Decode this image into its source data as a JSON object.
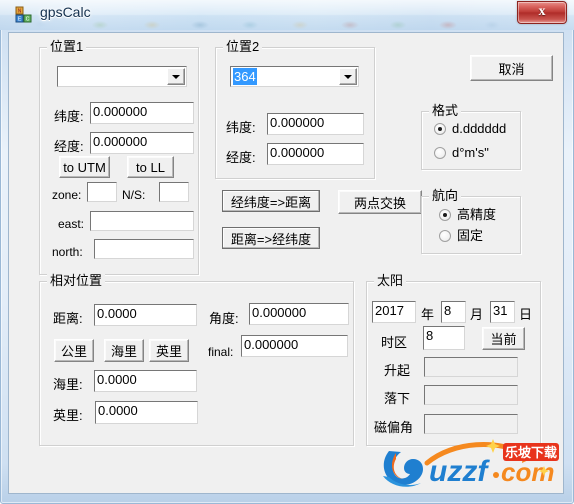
{
  "window": {
    "title": "gpsCalc",
    "icon": "app-blocks-icon",
    "close_label": "x"
  },
  "cancel_button": "取消",
  "position1": {
    "title": "位置1",
    "combo_value": "",
    "lat_label": "纬度:",
    "lat_value": "0.000000",
    "lon_label": "经度:",
    "lon_value": "0.000000",
    "to_utm": "to UTM",
    "to_ll": "to LL",
    "zone_label": "zone:",
    "zone_value": "",
    "ns_label": "N/S:",
    "ns_value": "",
    "east_label": "east:",
    "east_value": "",
    "north_label": "north:",
    "north_value": ""
  },
  "position2": {
    "title": "位置2",
    "combo_value": "364",
    "lat_label": "纬度:",
    "lat_value": "0.000000",
    "lon_label": "经度:",
    "lon_value": "0.000000"
  },
  "actions": {
    "latlon_to_dist": "经纬度=>距离",
    "dist_to_latlon": "距离=>经纬度",
    "swap_points": "两点交换"
  },
  "format": {
    "title": "格式",
    "options": [
      {
        "label": "d.dddddd",
        "selected": true
      },
      {
        "label": "d°m's\"",
        "selected": false
      }
    ]
  },
  "heading": {
    "title": "航向",
    "options": [
      {
        "label": "高精度",
        "selected": true
      },
      {
        "label": "固定",
        "selected": false
      }
    ]
  },
  "relative": {
    "title": "相对位置",
    "dist_label": "距离:",
    "dist_value": "0.0000",
    "angle_label": "角度:",
    "angle_value": "0.000000",
    "km_button": "公里",
    "nm_button": "海里",
    "mi_button": "英里",
    "final_label": "final:",
    "final_value": "0.000000",
    "nm_label": "海里:",
    "nm_value": "0.0000",
    "mi_label": "英里:",
    "mi_value": "0.0000"
  },
  "sun": {
    "title": "太阳",
    "year_value": "2017",
    "year_unit": "年",
    "month_value": "8",
    "month_unit": "月",
    "day_value": "31",
    "day_unit": "日",
    "tz_label": "时区",
    "tz_value": "8",
    "now_button": "当前",
    "rise_label": "升起",
    "rise_value": "",
    "set_label": "落下",
    "set_value": "",
    "decl_label": "磁偏角",
    "decl_value": ""
  },
  "watermark": {
    "main_text": "uzzf.com",
    "badge_text": "乐坡下载"
  },
  "colors": {
    "accent": "#3399ff",
    "close": "#bb3732",
    "face": "#f0f0f0",
    "title": "#15314e"
  }
}
